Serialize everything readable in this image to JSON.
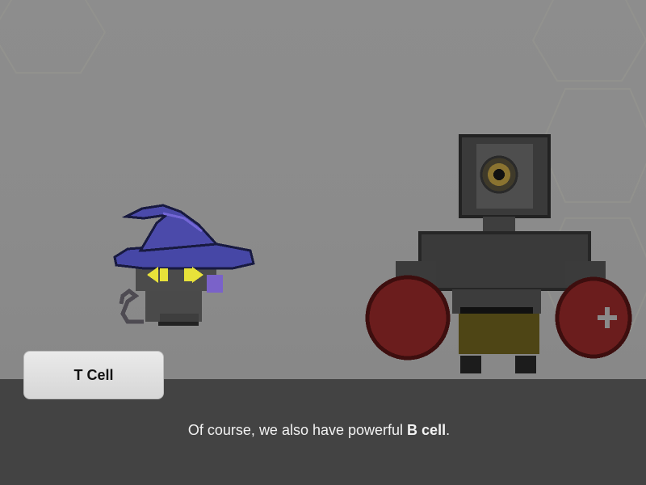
{
  "scene": {
    "characters": [
      "wizard-cat-t-cell",
      "cyclops-b-cell"
    ]
  },
  "dialog": {
    "speaker": "T Cell",
    "text_before": "Of course, we also have powerful ",
    "text_bold": "B cell",
    "text_after": "."
  },
  "colors": {
    "dialog_bg": "#434343",
    "speaker_box": "#e0e0e0",
    "hat": "#4a47a8",
    "eyes": "#e6df3a",
    "glove": "#6a1a1a",
    "pants": "#4d4416"
  }
}
